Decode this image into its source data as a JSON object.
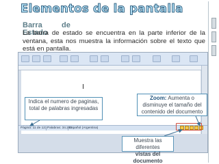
{
  "slide": {
    "title": "Elementos de la pantalla",
    "heading_word1": "Barra",
    "heading_word2": "de",
    "heading_word3": "Estado",
    "body": "La barra de estado se encuentra en la parte inferior de la ventana, esta nos muestra la información sobre el texto que está en pantalla."
  },
  "screenshot": {
    "status_page": "Página: 11 de 123",
    "status_words": "Palabras: 34.251",
    "status_lang": "Español (Argentina)",
    "cursor_glyph": "I"
  },
  "callouts": {
    "left": "Indica el numero de paginas, total de palabras ingresadas",
    "zoom_label": "Zoom:",
    "zoom_text": "Aumenta o disminuye el tamaño del contenido del documento",
    "views_line1": "Muestra las diferentes",
    "views_line2": "vistas del documento"
  },
  "colors": {
    "title_fill": "#aedcf2",
    "title_outline": "#16476a",
    "heading": "#5f7f8a",
    "callout_border": "#4f8fb5",
    "arrow": "#3d6f93",
    "highlight": "#d0503e"
  }
}
